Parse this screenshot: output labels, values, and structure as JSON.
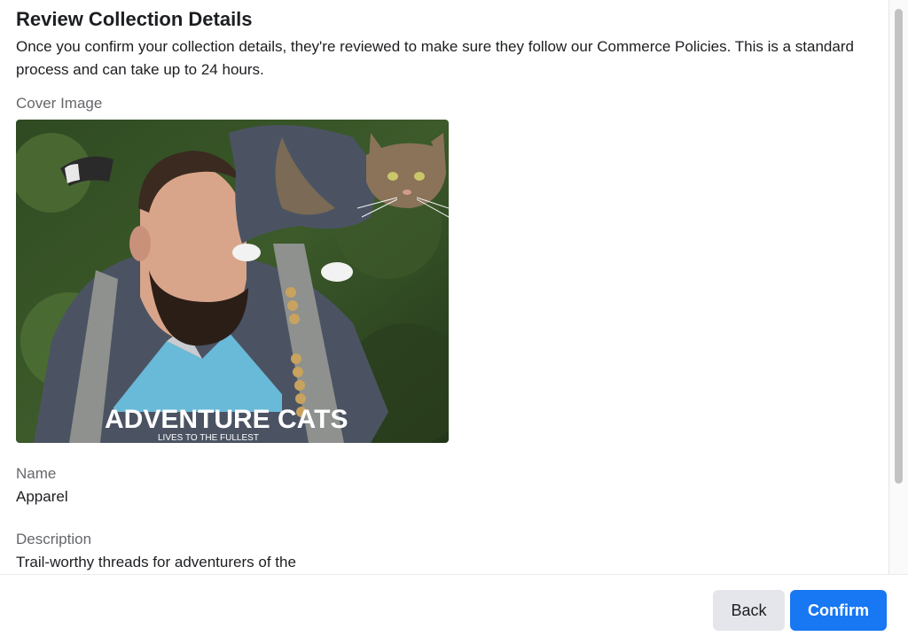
{
  "dialog": {
    "title": "Review Collection Details",
    "intro": "Once you confirm your collection details, they're reviewed to make sure they follow our Commerce Policies. This is a standard process and can take up to 24 hours."
  },
  "cover": {
    "label": "Cover Image",
    "shirt_text": "ADVENTURE CATS",
    "shirt_subtext": "LIVES TO THE FULLEST"
  },
  "fields": {
    "name_label": "Name",
    "name_value": "Apparel",
    "description_label": "Description",
    "description_value": "Trail-worthy threads for adventurers of the"
  },
  "footer": {
    "back_label": "Back",
    "confirm_label": "Confirm"
  },
  "colors": {
    "primary": "#1877f2",
    "secondary_button": "#e4e6eb",
    "label_gray": "#65676b"
  }
}
